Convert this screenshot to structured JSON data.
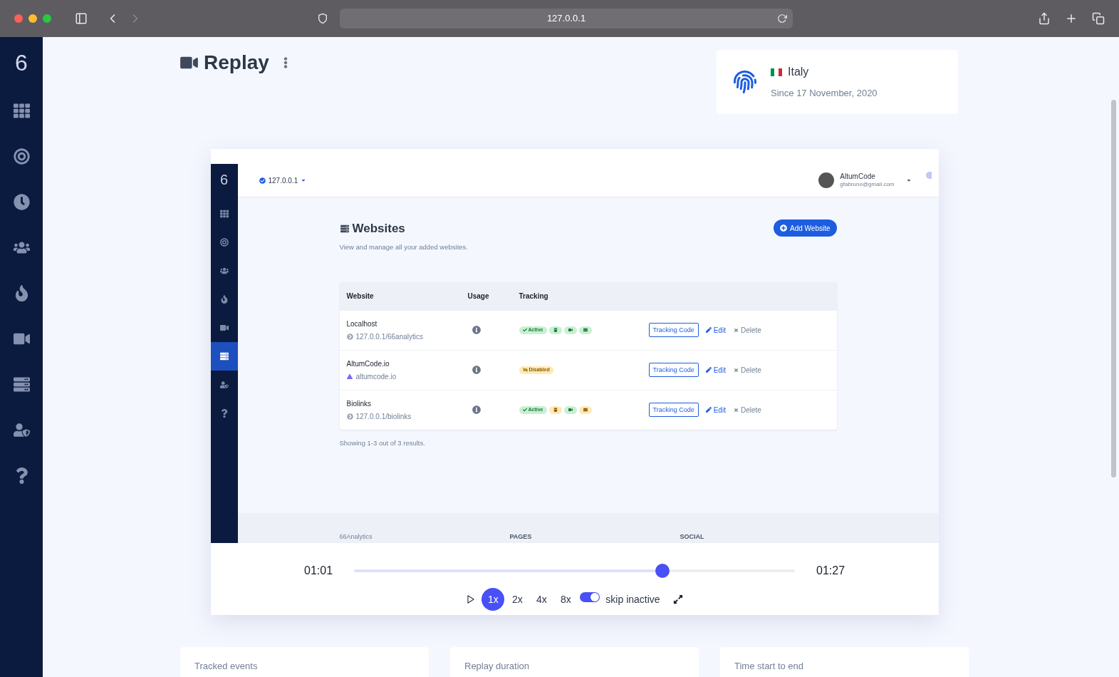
{
  "browser": {
    "address": "127.0.0.1"
  },
  "sidebar": {
    "logo": "6",
    "items": [
      {
        "kind": "grid"
      },
      {
        "kind": "target"
      },
      {
        "kind": "clock"
      },
      {
        "kind": "users"
      },
      {
        "kind": "fire"
      },
      {
        "kind": "video"
      },
      {
        "kind": "server"
      },
      {
        "kind": "user-shield"
      },
      {
        "kind": "help"
      }
    ]
  },
  "header": {
    "title": "Replay"
  },
  "visitor": {
    "country": "Italy",
    "since": "Since 17 November, 2020"
  },
  "recording": {
    "topbar": {
      "site": "127.0.0.1",
      "user_name": "AltumCode",
      "user_email": "gfabruno@gmail.com"
    },
    "sidebar": {
      "logo": "6",
      "items": [
        {
          "kind": "grid",
          "selected": false
        },
        {
          "kind": "target",
          "selected": false
        },
        {
          "kind": "users",
          "selected": false
        },
        {
          "kind": "fire",
          "selected": false
        },
        {
          "kind": "video",
          "selected": false
        },
        {
          "kind": "server",
          "selected": true
        },
        {
          "kind": "user-shield",
          "selected": false
        },
        {
          "kind": "help",
          "selected": false
        }
      ]
    },
    "page": {
      "title": "Websites",
      "subtitle": "View and manage all your added websites.",
      "add_button": "Add Website"
    },
    "table": {
      "columns": [
        "Website",
        "Usage",
        "Tracking"
      ],
      "rows": [
        {
          "name": "Localhost",
          "url": "127.0.0.1/66analytics",
          "kind": "generic",
          "status": {
            "kind": "active",
            "label": "Active"
          },
          "features": [
            {
              "kind": "mouse",
              "enabled": true
            },
            {
              "kind": "video",
              "enabled": true
            },
            {
              "kind": "mail",
              "enabled": true
            }
          ],
          "code_button": "Tracking Code",
          "edit": "Edit",
          "delete": "Delete"
        },
        {
          "name": "AltumCode.io",
          "url": "altumcode.io",
          "kind": "favicon",
          "status": {
            "kind": "disabled",
            "label": "Disabled"
          },
          "features": [],
          "code_button": "Tracking Code",
          "edit": "Edit",
          "delete": "Delete"
        },
        {
          "name": "Biolinks",
          "url": "127.0.0.1/biolinks",
          "kind": "generic",
          "status": {
            "kind": "active",
            "label": "Active"
          },
          "features": [
            {
              "kind": "mouse",
              "enabled": false
            },
            {
              "kind": "video",
              "enabled": true
            },
            {
              "kind": "mail",
              "enabled": false
            }
          ],
          "code_button": "Tracking Code",
          "edit": "Edit",
          "delete": "Delete"
        }
      ]
    },
    "results": "Showing 1-3 out of 3 results.",
    "footer": [
      "66Analytics",
      "PAGES",
      "SOCIAL"
    ]
  },
  "player": {
    "current": "01:01",
    "total": "01:27",
    "level": 0.7,
    "speeds": [
      {
        "label": "1x",
        "selected": true
      },
      {
        "label": "2x",
        "selected": false
      },
      {
        "label": "4x",
        "selected": false
      },
      {
        "label": "8x",
        "selected": false
      }
    ],
    "skip_inactive": {
      "label": "skip inactive",
      "on": true
    }
  },
  "stats": [
    {
      "label": "Tracked events"
    },
    {
      "label": "Replay duration"
    },
    {
      "label": "Time start to end"
    }
  ]
}
